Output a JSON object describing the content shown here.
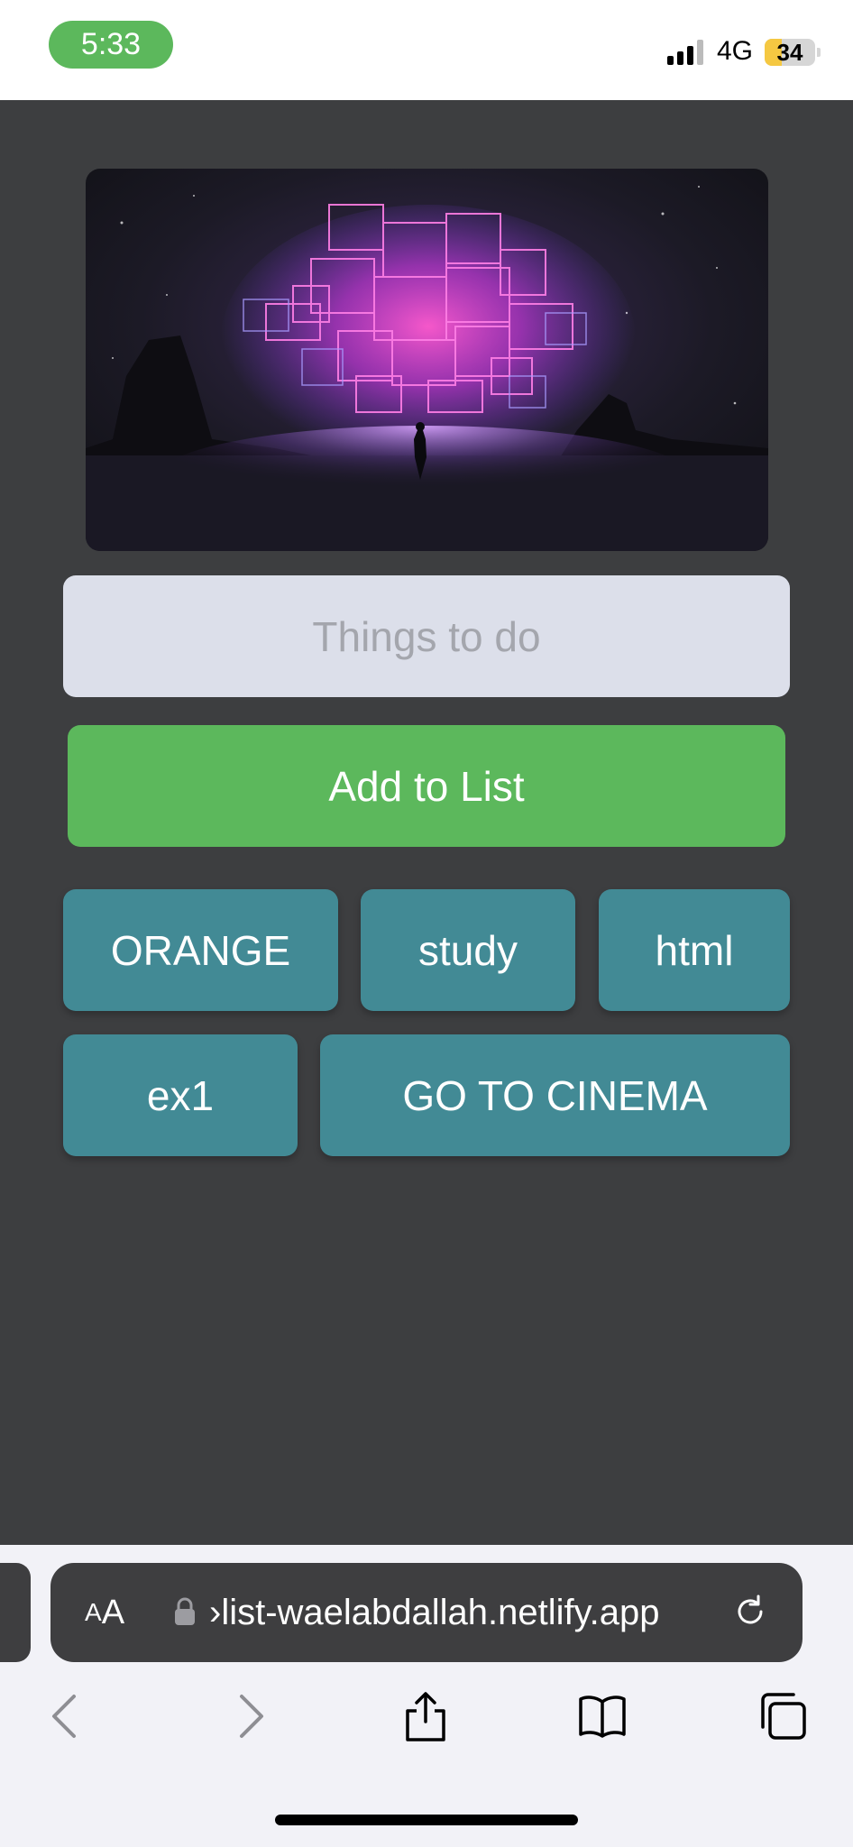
{
  "status_bar": {
    "time": "5:33",
    "network": "4G",
    "battery_level": "34",
    "battery_fraction": 0.34,
    "colors": {
      "time_pill": "#5cb85c",
      "battery_fill": "#f5c842"
    }
  },
  "app": {
    "hero_image": {
      "icon": "neon-cube-cloud-image"
    },
    "input": {
      "placeholder": "Things to do",
      "value": ""
    },
    "add_button": {
      "label": "Add to List"
    },
    "items": [
      {
        "label": "ORANGE"
      },
      {
        "label": "study"
      },
      {
        "label": "html"
      },
      {
        "label": "ex1"
      },
      {
        "label": "GO TO CINEMA"
      }
    ],
    "colors": {
      "background": "#3d3e40",
      "accent_green": "#5cb85c",
      "item_teal": "#428a95",
      "input_bg": "#dcdfea"
    }
  },
  "browser": {
    "aa_label_small": "A",
    "aa_label_large": "A",
    "url": "›list-waelabdallah.netlify.app",
    "icons": [
      "lock-icon",
      "reload-icon",
      "back-icon",
      "forward-icon",
      "share-icon",
      "bookmarks-icon",
      "tabs-icon"
    ]
  }
}
